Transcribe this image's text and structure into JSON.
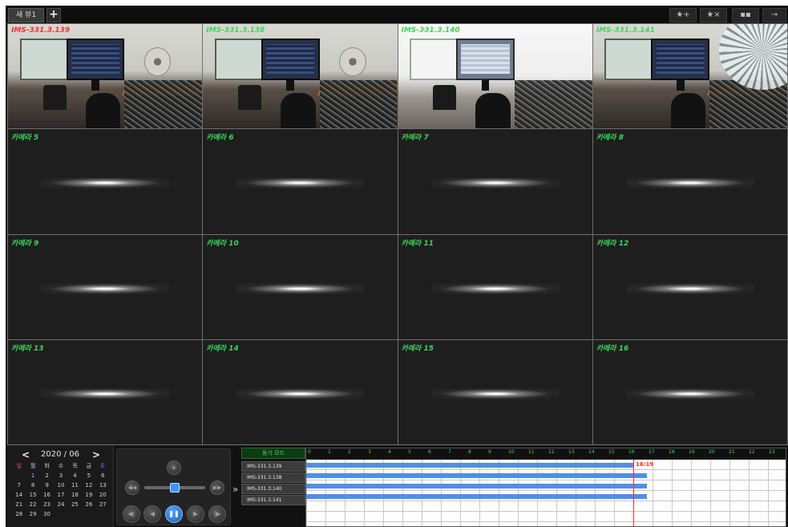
{
  "toolbar": {
    "tab_label": "새 뷰1",
    "add_tab_icon": "+",
    "fav_add_label": "★+",
    "fav_remove_label": "★×",
    "layout_icon": "▪▪",
    "exit_icon": "→"
  },
  "cameras": [
    {
      "label": "IMS-331.3.139",
      "active": true
    },
    {
      "label": "IMS-331.3.138"
    },
    {
      "label": "IMS-331.3.140"
    },
    {
      "label": "IMS-331.3.141"
    },
    {
      "label": "카메라 5"
    },
    {
      "label": "카메라 6"
    },
    {
      "label": "카메라 7"
    },
    {
      "label": "카메라 8"
    },
    {
      "label": "카메라 9"
    },
    {
      "label": "카메라 10"
    },
    {
      "label": "카메라 11"
    },
    {
      "label": "카메라 12"
    },
    {
      "label": "카메라 13"
    },
    {
      "label": "카메라 14"
    },
    {
      "label": "카메라 15"
    },
    {
      "label": "카메라 16"
    }
  ],
  "calendar": {
    "prev": "<",
    "next": ">",
    "month_label": "2020 / 06",
    "weekdays": [
      "일",
      "월",
      "화",
      "수",
      "목",
      "금",
      "토"
    ],
    "days": [
      "",
      "1",
      "2",
      "3",
      "4",
      "5",
      "6",
      "7",
      "8",
      "9",
      "10",
      "11",
      "12",
      "13",
      "14",
      "15",
      "16",
      "17",
      "18",
      "19",
      "20",
      "21",
      "22",
      "23",
      "24",
      "25",
      "26",
      "27",
      "28",
      "29",
      "30",
      "",
      "",
      "",
      ""
    ]
  },
  "player": {
    "icons": [
      "skip-back-icon",
      "skip-forward-icon",
      "step-back-icon",
      "rewind-icon",
      "pause-icon",
      "play-icon",
      "step-forward-icon"
    ],
    "speed_level": 0.5,
    "expand_label": "»"
  },
  "devices": {
    "header": "동기 모드",
    "items": [
      "IMS-331.3.139",
      "IMS-331.3.138",
      "IMS-331.3.140",
      "IMS-331.3.141"
    ]
  },
  "timeline": {
    "hours": [
      "0",
      "1",
      "2",
      "3",
      "4",
      "5",
      "6",
      "7",
      "8",
      "9",
      "10",
      "11",
      "12",
      "13",
      "14",
      "15",
      "16",
      "17",
      "18",
      "19",
      "20",
      "21",
      "22",
      "23"
    ],
    "now_label": "16:19",
    "recorded_until_hours": [
      16.3,
      17.0,
      17.0,
      17.0
    ],
    "accent": "#4f8fe6",
    "now_color": "#ff2a2a"
  }
}
